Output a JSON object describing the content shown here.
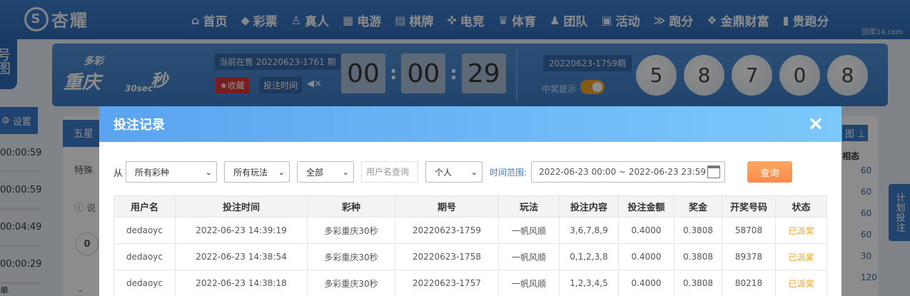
{
  "logo": {
    "mark": "S",
    "text": "杏耀"
  },
  "nav": [
    {
      "icon": "home-icon",
      "glyph": "⌂",
      "label": "首页"
    },
    {
      "icon": "lottery-icon",
      "glyph": "◆",
      "label": "彩票"
    },
    {
      "icon": "live-icon",
      "glyph": "♙",
      "label": "真人"
    },
    {
      "icon": "slot-icon",
      "glyph": "▦",
      "label": "电游"
    },
    {
      "icon": "cards-icon",
      "glyph": "▤",
      "label": "棋牌"
    },
    {
      "icon": "gamepad-icon",
      "glyph": "✜",
      "label": "电竞"
    },
    {
      "icon": "trophy-icon",
      "glyph": "♛",
      "label": "体育"
    },
    {
      "icon": "team-icon",
      "glyph": "♟",
      "label": "团队"
    },
    {
      "icon": "gift-icon",
      "glyph": "▣",
      "label": "活动"
    },
    {
      "icon": "run-icon",
      "glyph": "≫",
      "label": "跑分"
    },
    {
      "icon": "money-icon",
      "glyph": "❖",
      "label": "金鼎财富"
    },
    {
      "icon": "run-icon-2",
      "glyph": "▮",
      "label": "贵跑分"
    }
  ],
  "watermark": "回家14.com",
  "left": {
    "tab": "号图",
    "settings": "设置",
    "times": [
      "00:00:59",
      "00:00:59",
      "00:04:49",
      "00:00:29"
    ],
    "bottom": "单"
  },
  "game": {
    "brand_top": "多彩",
    "brand_name": "重庆",
    "brand_sec": "30sec",
    "brand_miao": "秒",
    "sale_info": "当前在售 20220623-1761 期",
    "fav_label": "★收藏",
    "bet_time_label": "投注时间",
    "timer": [
      "00",
      "00",
      "29"
    ],
    "last_issue": "20220623-1759期",
    "win_tip": "中奖提示",
    "balls": [
      "5",
      "8",
      "7",
      "0",
      "8"
    ]
  },
  "background": {
    "tab_five": "五星",
    "special": "特殊",
    "note": "说",
    "zero": "0",
    "minus": "-",
    "hist": "图",
    "col_head": "相态",
    "col_values": [
      "60",
      "60",
      "60",
      "60",
      "30",
      "120"
    ],
    "plan": "计划投注"
  },
  "modal": {
    "title": "投注记录",
    "close": "×",
    "from_label": "从",
    "lottery_select": "所有彩种",
    "play_select": "所有玩法",
    "status_select": "全部",
    "user_placeholder": "用户名查询",
    "scope_select": "个人",
    "range_label": "时间范围:",
    "range_value": "2022-06-23 00:00 ~ 2022-06-23 23:59",
    "query_label": "查询",
    "columns": [
      "用户名",
      "投注时间",
      "彩种",
      "期号",
      "玩法",
      "投注内容",
      "投注金额",
      "奖金",
      "开奖号码",
      "状态"
    ],
    "rows": [
      [
        "dedaoyc",
        "2022-06-23 14:39:19",
        "多彩重庆30秒",
        "20220623-1759",
        "一帆风顺",
        "3,6,7,8,9",
        "0.4000",
        "0.3808",
        "58708",
        "已派奖"
      ],
      [
        "dedaoyc",
        "2022-06-23 14:38:54",
        "多彩重庆30秒",
        "20220623-1758",
        "一帆风顺",
        "0,1,2,3,8",
        "0.4000",
        "0.3808",
        "89378",
        "已派奖"
      ],
      [
        "dedaoyc",
        "2022-06-23 14:38:18",
        "多彩重庆30秒",
        "20220623-1757",
        "一帆风顺",
        "1,2,3,4,5",
        "0.4000",
        "0.3808",
        "80218",
        "已派奖"
      ]
    ]
  }
}
